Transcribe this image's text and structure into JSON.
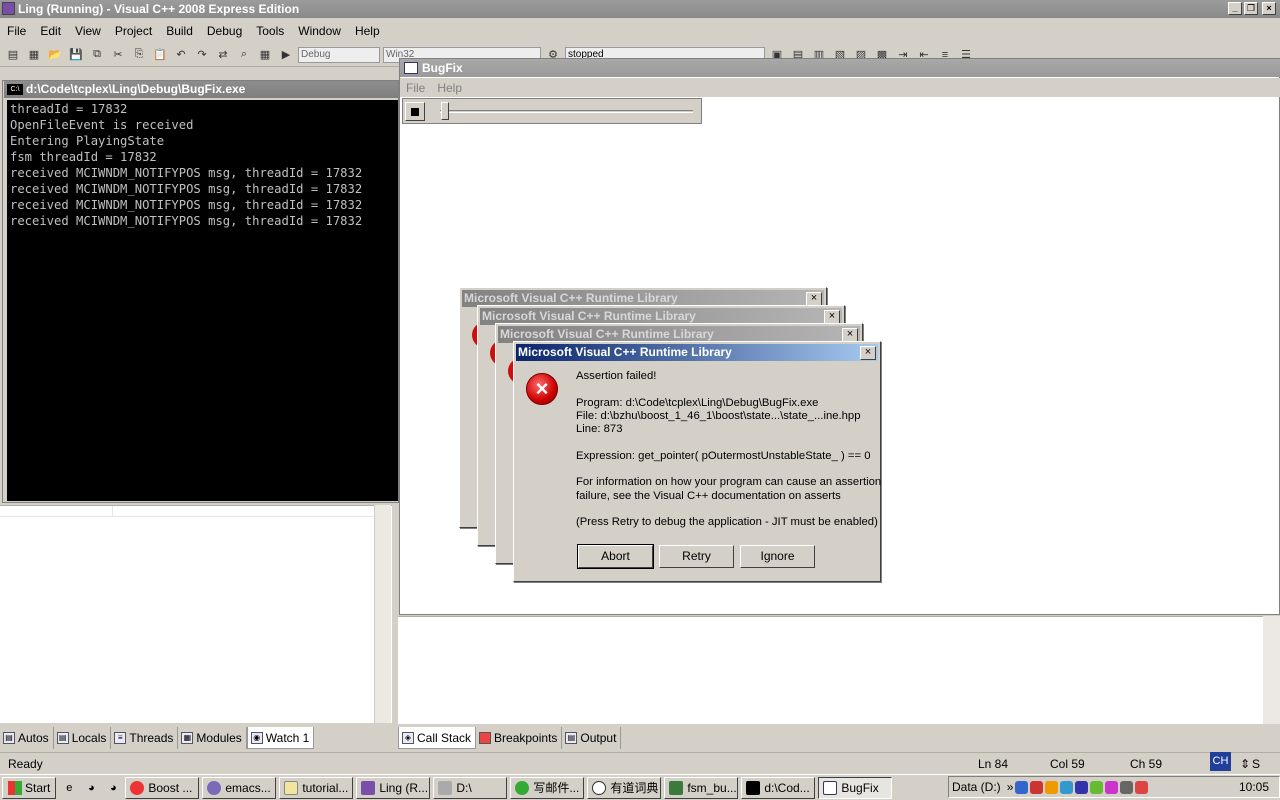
{
  "vs": {
    "title": "Ling (Running) - Visual C++ 2008 Express Edition",
    "menu": [
      "File",
      "Edit",
      "View",
      "Project",
      "Build",
      "Debug",
      "Tools",
      "Window",
      "Help"
    ],
    "toolbar": {
      "config_combo": "Debug",
      "platform_combo": "Win32",
      "process_combo": "stopped"
    }
  },
  "console": {
    "title": "d:\\Code\\tcplex\\Ling\\Debug\\BugFix.exe",
    "icon_label": "C:\\",
    "lines": "threadId = 17832\nOpenFileEvent is received\nEntering PlayingState\nfsm threadId = 17832\nreceived MCIWNDM_NOTIFYPOS msg, threadId = 17832\nreceived MCIWNDM_NOTIFYPOS msg, threadId = 17832\nreceived MCIWNDM_NOTIFYPOS msg, threadId = 17832\nreceived MCIWNDM_NOTIFYPOS msg, threadId = 17832"
  },
  "bugfix": {
    "title": "BugFix",
    "menu": [
      "File",
      "Help"
    ],
    "slider_position": 0
  },
  "dialogs": {
    "background_title": "Microsoft Visual C++ Runtime Library",
    "main": {
      "title": "Microsoft Visual C++ Runtime Library",
      "icon": "error-icon",
      "message": "Assertion failed!\n\nProgram: d:\\Code\\tcplex\\Ling\\Debug\\BugFix.exe\nFile: d:\\bzhu\\boost_1_46_1\\boost\\state...\\state_...ine.hpp\nLine: 873\n\nExpression: get_pointer( pOutermostUnstableState_ ) == 0\n\nFor information on how your program can cause an assertion\nfailure, see the Visual C++ documentation on asserts\n\n(Press Retry to debug the application - JIT must be enabled)",
      "buttons": [
        "Abort",
        "Retry",
        "Ignore"
      ]
    }
  },
  "tabs_left": [
    "Autos",
    "Locals",
    "Threads",
    "Modules",
    "Watch 1"
  ],
  "tabs_right": [
    "Call Stack",
    "Breakpoints",
    "Output"
  ],
  "status": {
    "text": "Ready",
    "ln": "Ln 84",
    "col": "Col 59",
    "ch": "Ch 59",
    "ime": "CH",
    "ime_extra": "S"
  },
  "taskbar": {
    "start": "Start",
    "tasks": [
      "Boost ...",
      "emacs...",
      "tutorial...",
      "Ling (R...",
      "D:\\",
      "写邮件...",
      "有道词典",
      "fsm_bu...",
      "d:\\Cod...",
      "BugFix"
    ],
    "tray_label": "Data (D:)",
    "clock": "10:05"
  }
}
